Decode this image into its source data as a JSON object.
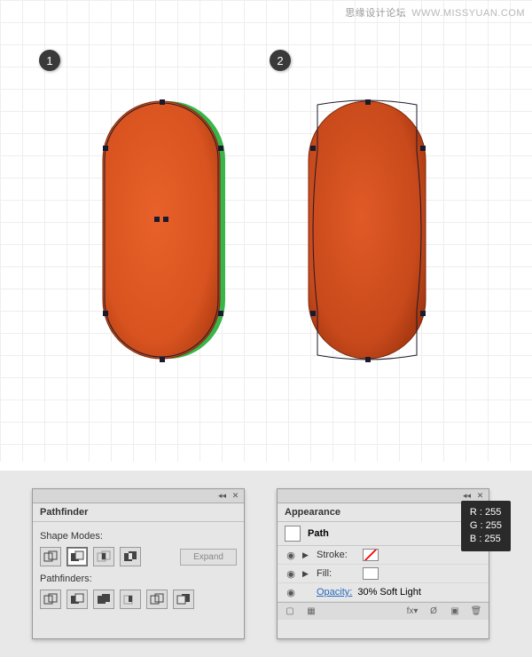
{
  "watermark": {
    "cn": "思缘设计论坛",
    "en": "WWW.MISSYUAN.COM"
  },
  "badges": {
    "b1": "1",
    "b2": "2"
  },
  "pathfinder": {
    "title": "Pathfinder",
    "shape_modes_label": "Shape Modes:",
    "expand_label": "Expand",
    "pathfinders_label": "Pathfinders:"
  },
  "appearance": {
    "title": "Appearance",
    "object_label": "Path",
    "stroke_label": "Stroke:",
    "fill_label": "Fill:",
    "opacity_link": "Opacity:",
    "opacity_value": "30% Soft Light"
  },
  "rgb": {
    "r": "R : 255",
    "g": "G : 255",
    "b": "B : 255"
  }
}
